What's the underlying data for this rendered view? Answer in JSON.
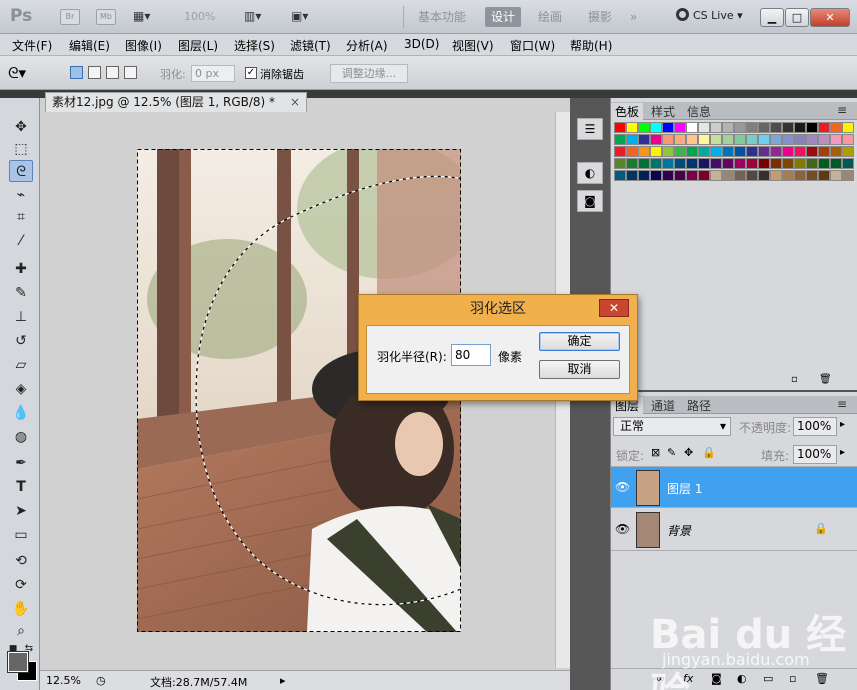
{
  "titlebar": {
    "logo": "Ps",
    "badge_br": "Br",
    "badge_mb": "Mb",
    "zoom": "100%",
    "workspaces": [
      "基本功能",
      "设计",
      "绘画",
      "摄影"
    ],
    "active_workspace": "设计",
    "more": "»",
    "cslive": "CS Live",
    "min": "▁",
    "max": "□",
    "close": "✕"
  },
  "menu": [
    "文件(F)",
    "编辑(E)",
    "图像(I)",
    "图层(L)",
    "选择(S)",
    "滤镜(T)",
    "分析(A)",
    "3D(D)",
    "视图(V)",
    "窗口(W)",
    "帮助(H)"
  ],
  "options": {
    "feather_label": "羽化:",
    "feather_value": "0 px",
    "antialias_label": "消除锯齿",
    "antialias_checked": "✓",
    "refine_edge": "调整边缘..."
  },
  "document": {
    "tab_title": "素材12.jpg @ 12.5% (图层 1, RGB/8) *",
    "tab_close": "×",
    "status_zoom": "12.5%",
    "status_doc": "文档:28.7M/57.4M"
  },
  "swatches_panel": {
    "tabs": [
      "色板",
      "样式",
      "信息"
    ],
    "active_tab": "色板",
    "colors": [
      [
        "#ff0000",
        "#ffff00",
        "#00ff00",
        "#00ffff",
        "#0000ff",
        "#ff00ff",
        "#ffffff",
        "#e6e6e6",
        "#cccccc",
        "#b3b3b3",
        "#999999",
        "#808080",
        "#666666",
        "#4d4d4d",
        "#333333",
        "#1a1a1a",
        "#000000",
        "#ed1c24",
        "#f26522",
        "#fff200"
      ],
      [
        "#00a651",
        "#00aeef",
        "#2e3192",
        "#ec008c",
        "#f7977a",
        "#f9ad81",
        "#fdc68a",
        "#fff79a",
        "#c4df9b",
        "#a3d39c",
        "#82ca9d",
        "#7accc8",
        "#6dcff6",
        "#7da7d9",
        "#8393ca",
        "#8781bd",
        "#a187be",
        "#bc8dbf",
        "#f49ac2",
        "#f6989d"
      ],
      [
        "#ed1c24",
        "#f26522",
        "#f7941d",
        "#fff200",
        "#8dc63f",
        "#39b54a",
        "#00a651",
        "#00a99d",
        "#00aeef",
        "#0072bc",
        "#0054a6",
        "#2e3192",
        "#662d91",
        "#92278f",
        "#ec008c",
        "#ed145b",
        "#9e0b0f",
        "#a0410d",
        "#a3620a",
        "#aba000"
      ],
      [
        "#598527",
        "#1a7b30",
        "#007236",
        "#00746b",
        "#0076a3",
        "#004b80",
        "#003471",
        "#1b1464",
        "#440e62",
        "#630460",
        "#9e005d",
        "#9e0039",
        "#790000",
        "#7b2e00",
        "#7d4900",
        "#827b00",
        "#406618",
        "#005e20",
        "#005826",
        "#005952"
      ],
      [
        "#005b7f",
        "#003663",
        "#002157",
        "#0d004c",
        "#32004b",
        "#4b0049",
        "#7b0046",
        "#7a0026",
        "#c7b299",
        "#998675",
        "#736357",
        "#534741",
        "#37302d",
        "#c69c6d",
        "#a67c52",
        "#8c6239",
        "#754c24",
        "#603913",
        "#c7b299",
        "#998675"
      ]
    ]
  },
  "layers_panel": {
    "tabs": [
      "图层",
      "通道",
      "路径"
    ],
    "active_tab": "图层",
    "blend_mode": "正常",
    "opacity_label": "不透明度:",
    "opacity_value": "100%",
    "lock_label": "锁定:",
    "fill_label": "填充:",
    "fill_value": "100%",
    "layers": [
      {
        "name": "图层 1",
        "selected": true,
        "locked": false
      },
      {
        "name": "背景",
        "selected": false,
        "locked": true
      }
    ]
  },
  "dialog": {
    "title": "羽化选区",
    "close": "✕",
    "radius_label": "羽化半径(R):",
    "radius_value": "80",
    "unit": "像素",
    "ok": "确定",
    "cancel": "取消"
  },
  "watermark": {
    "logo": "Bai du 经验",
    "url": "jingyan.baidu.com"
  },
  "colors": {
    "accent": "#3fa1f0",
    "dialog_frame": "#f0b04c"
  }
}
